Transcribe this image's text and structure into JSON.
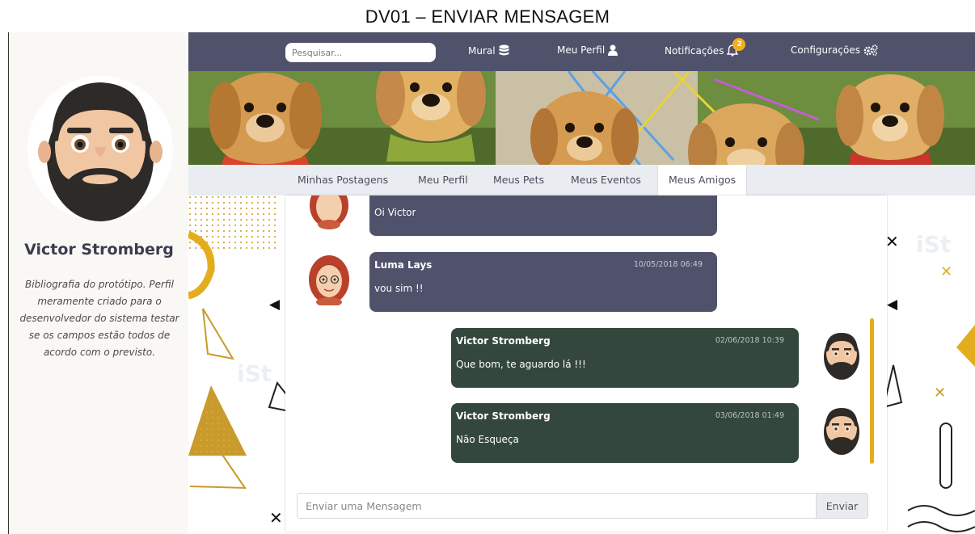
{
  "document": {
    "title": "DV01 – ENVIAR MENSAGEM"
  },
  "profile": {
    "name": "Victor Stromberg",
    "bio": "Bibliografia do protótipo. Perfil meramente criado para o desenvolvedor do sistema testar se os campos estão todos de acordo com o previsto."
  },
  "nav": {
    "search_placeholder": "Pesquisar...",
    "items": [
      {
        "label": "Mural",
        "icon": "database-icon"
      },
      {
        "label": "Meu Perfil",
        "icon": "user-icon"
      },
      {
        "label": "Notificações",
        "icon": "bell-icon",
        "badge": "2"
      },
      {
        "label": "Configurações",
        "icon": "gears-icon"
      }
    ]
  },
  "tabs": [
    "Minhas Postagens",
    "Meu Perfil",
    "Meus Pets",
    "Meus Eventos",
    "Meus Amigos"
  ],
  "active_tab": "Meus Amigos",
  "messages": [
    {
      "text": "Oi Victor",
      "direction": "received"
    },
    {
      "sender": "Luma Lays",
      "time": "10/05/2018 06:49",
      "text": "vou sim !!",
      "direction": "received"
    },
    {
      "sender": "Victor Stromberg",
      "time": "02/06/2018 10:39",
      "text": "Que bom, te aguardo lá !!!",
      "direction": "sent"
    },
    {
      "sender": "Victor Stromberg",
      "time": "03/06/2018 01:49",
      "text": "Não Esqueça",
      "direction": "sent"
    }
  ],
  "composer": {
    "placeholder": "Enviar uma Mensagem",
    "send_label": "Enviar"
  },
  "colors": {
    "navbar": "#50516a",
    "received_bubble": "#50516a",
    "sent_bubble": "#34473c",
    "accent": "#e3ad1d",
    "badge": "#f2b01e"
  }
}
